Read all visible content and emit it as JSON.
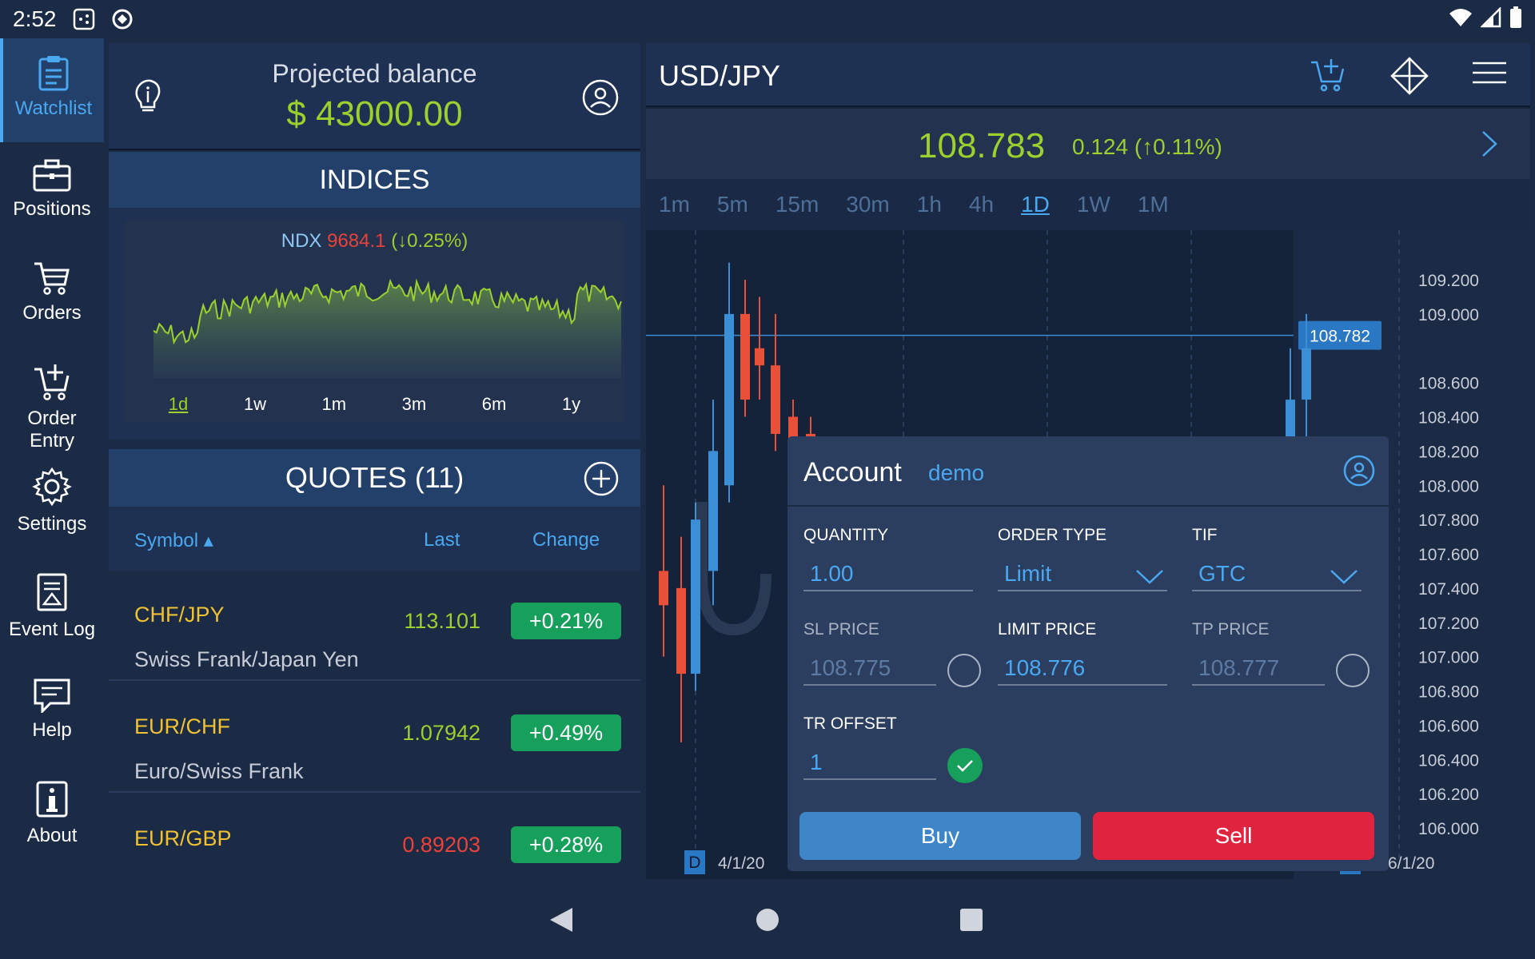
{
  "status": {
    "time": "2:52"
  },
  "nav": {
    "items": [
      {
        "label": "Watchlist"
      },
      {
        "label": "Positions"
      },
      {
        "label": "Orders"
      },
      {
        "label": "Order Entry"
      },
      {
        "label": "Settings"
      },
      {
        "label": "Event Log"
      },
      {
        "label": "Help"
      },
      {
        "label": "About"
      }
    ]
  },
  "balance": {
    "title": "Projected balance",
    "value": "$ 43000.00"
  },
  "indices": {
    "title": "INDICES",
    "symbol": "NDX",
    "value": "9684.1",
    "change": "(↓0.25%)",
    "ranges": [
      "1d",
      "1w",
      "1m",
      "3m",
      "6m",
      "1y"
    ],
    "selected_range": "1d"
  },
  "quotes": {
    "title": "QUOTES (11)",
    "columns": {
      "symbol": "Symbol ▴",
      "last": "Last",
      "change": "Change"
    },
    "rows": [
      {
        "symbol": "CHF/JPY",
        "name": "Swiss Frank/Japan Yen",
        "last": "113.101",
        "change": "+0.21%"
      },
      {
        "symbol": "EUR/CHF",
        "name": "Euro/Swiss Frank",
        "last": "1.07942",
        "change": "+0.49%"
      },
      {
        "symbol": "EUR/GBP",
        "name": "",
        "last": "0.89203",
        "change": "+0.28%"
      }
    ]
  },
  "instrument": {
    "pair": "USD/JPY",
    "price": "108.783",
    "change": "0.124 (↑0.11%)",
    "timeframes": [
      "1m",
      "5m",
      "15m",
      "30m",
      "1h",
      "4h",
      "1D",
      "1W",
      "1M"
    ],
    "selected_timeframe": "1D"
  },
  "chart_data": {
    "type": "candlestick",
    "current_price_label": "108.782",
    "y_ticks": [
      "109.200",
      "109.000",
      "108.600",
      "108.400",
      "108.200",
      "108.000",
      "107.800",
      "107.600",
      "107.400",
      "107.200",
      "107.000",
      "106.800",
      "106.600",
      "106.400",
      "106.200",
      "106.000"
    ],
    "x_labels": [
      "4/1/20",
      "6/1/20"
    ],
    "period_marker": "D",
    "up_color": "#3b8fd6",
    "down_color": "#e8503a"
  },
  "order": {
    "title": "Account",
    "account": "demo",
    "quantity_label": "QUANTITY",
    "quantity": "1.00",
    "order_type_label": "ORDER TYPE",
    "order_type": "Limit",
    "tif_label": "TIF",
    "tif": "GTC",
    "sl_label": "SL PRICE",
    "sl": "108.775",
    "limit_label": "LIMIT PRICE",
    "limit": "108.776",
    "tp_label": "TP PRICE",
    "tp": "108.777",
    "tr_label": "TR OFFSET",
    "tr": "1",
    "buy": "Buy",
    "sell": "Sell"
  }
}
